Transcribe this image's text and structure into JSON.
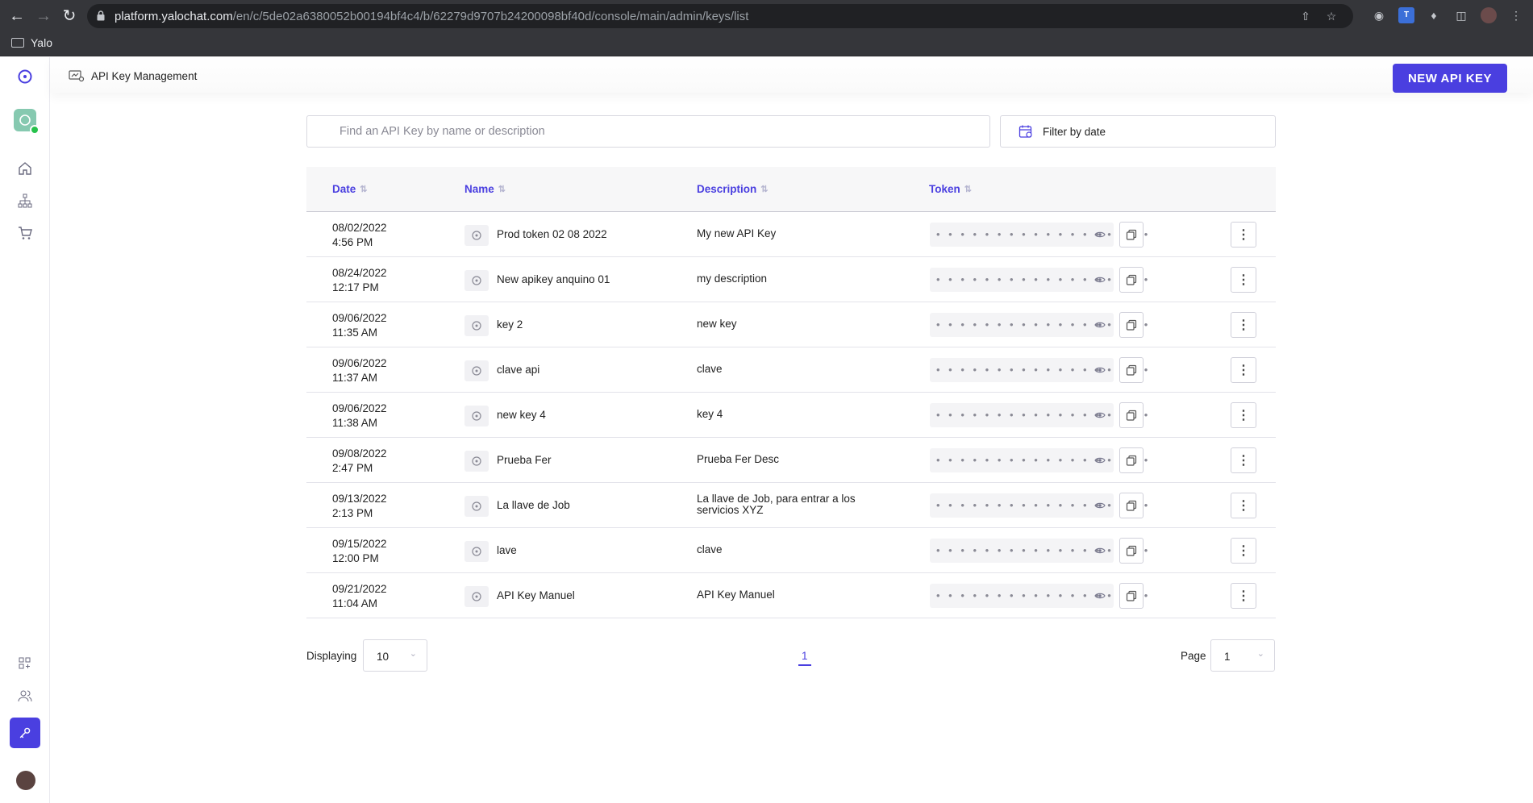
{
  "browser": {
    "url_host": "platform.yalochat.com",
    "url_path": "/en/c/5de02a6380052b00194bf4c4/b/62279d9707b24200098bf40d/console/main/admin/keys/list",
    "bookmark_label": "Yalo"
  },
  "header": {
    "title": "API Key Management",
    "new_key_label": "NEW API KEY"
  },
  "search": {
    "placeholder": "Find an API Key by name or description"
  },
  "filter": {
    "label": "Filter by date"
  },
  "table": {
    "columns": [
      "Date",
      "Name",
      "Description",
      "Token"
    ],
    "token_mask": "• • • • • • • • • • • • • • • • • •",
    "rows": [
      {
        "date": "08/02/2022",
        "time": "4:56 PM",
        "name": "Prod token 02 08 2022",
        "description": "My new API Key"
      },
      {
        "date": "08/24/2022",
        "time": "12:17 PM",
        "name": "New apikey anquino 01",
        "description": "my description"
      },
      {
        "date": "09/06/2022",
        "time": "11:35 AM",
        "name": "key 2",
        "description": "new key"
      },
      {
        "date": "09/06/2022",
        "time": "11:37 AM",
        "name": "clave api",
        "description": "clave"
      },
      {
        "date": "09/06/2022",
        "time": "11:38 AM",
        "name": "new key 4",
        "description": "key 4"
      },
      {
        "date": "09/08/2022",
        "time": "2:47 PM",
        "name": "Prueba Fer",
        "description": "Prueba Fer Desc"
      },
      {
        "date": "09/13/2022",
        "time": "2:13 PM",
        "name": "La llave de Job",
        "description": "La llave de Job, para entrar a los servicios XYZ"
      },
      {
        "date": "09/15/2022",
        "time": "12:00 PM",
        "name": "lave",
        "description": "clave"
      },
      {
        "date": "09/21/2022",
        "time": "11:04 AM",
        "name": "API Key Manuel",
        "description": "API Key Manuel"
      }
    ]
  },
  "pagination": {
    "displaying_label": "Displaying",
    "per_page": "10",
    "current_page": "1",
    "page_label": "Page",
    "page_select": "1"
  },
  "colors": {
    "accent": "#4a3fe0"
  }
}
